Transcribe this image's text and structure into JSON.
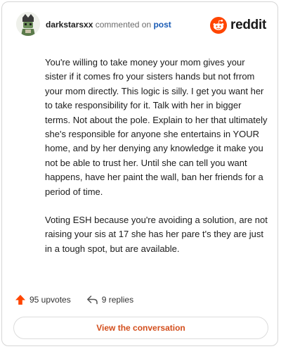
{
  "header": {
    "username": "darkstarsxx",
    "action_text": "commented on",
    "post_link": "post",
    "brand": "reddit",
    "brand_color": "#ff4500"
  },
  "comment": {
    "paragraphs": [
      "You're willing to take money your mom gives your sister if it comes fro your sisters hands but not frrom your mom directly. This logic is silly. I get you want her to take responsibility for it. Talk with her in bigger terms. Not about the pole. Explain to her that ultimately she's responsible for anyone she entertains in YOUR home, and by her denying any knowledge it make you not be able to trust her. Until she can tell you want happens, have her paint the wall, ban her friends for a period of time.",
      "Voting ESH because you're avoiding a solution, are not raising your sis at 17 she has her pare t's they are just in a tough spot, but are available."
    ]
  },
  "footer": {
    "upvotes_label": "95 upvotes",
    "replies_label": "9 replies",
    "cta_label": "View the conversation",
    "upvote_color": "#ff4500",
    "cta_color": "#d34e1c"
  }
}
